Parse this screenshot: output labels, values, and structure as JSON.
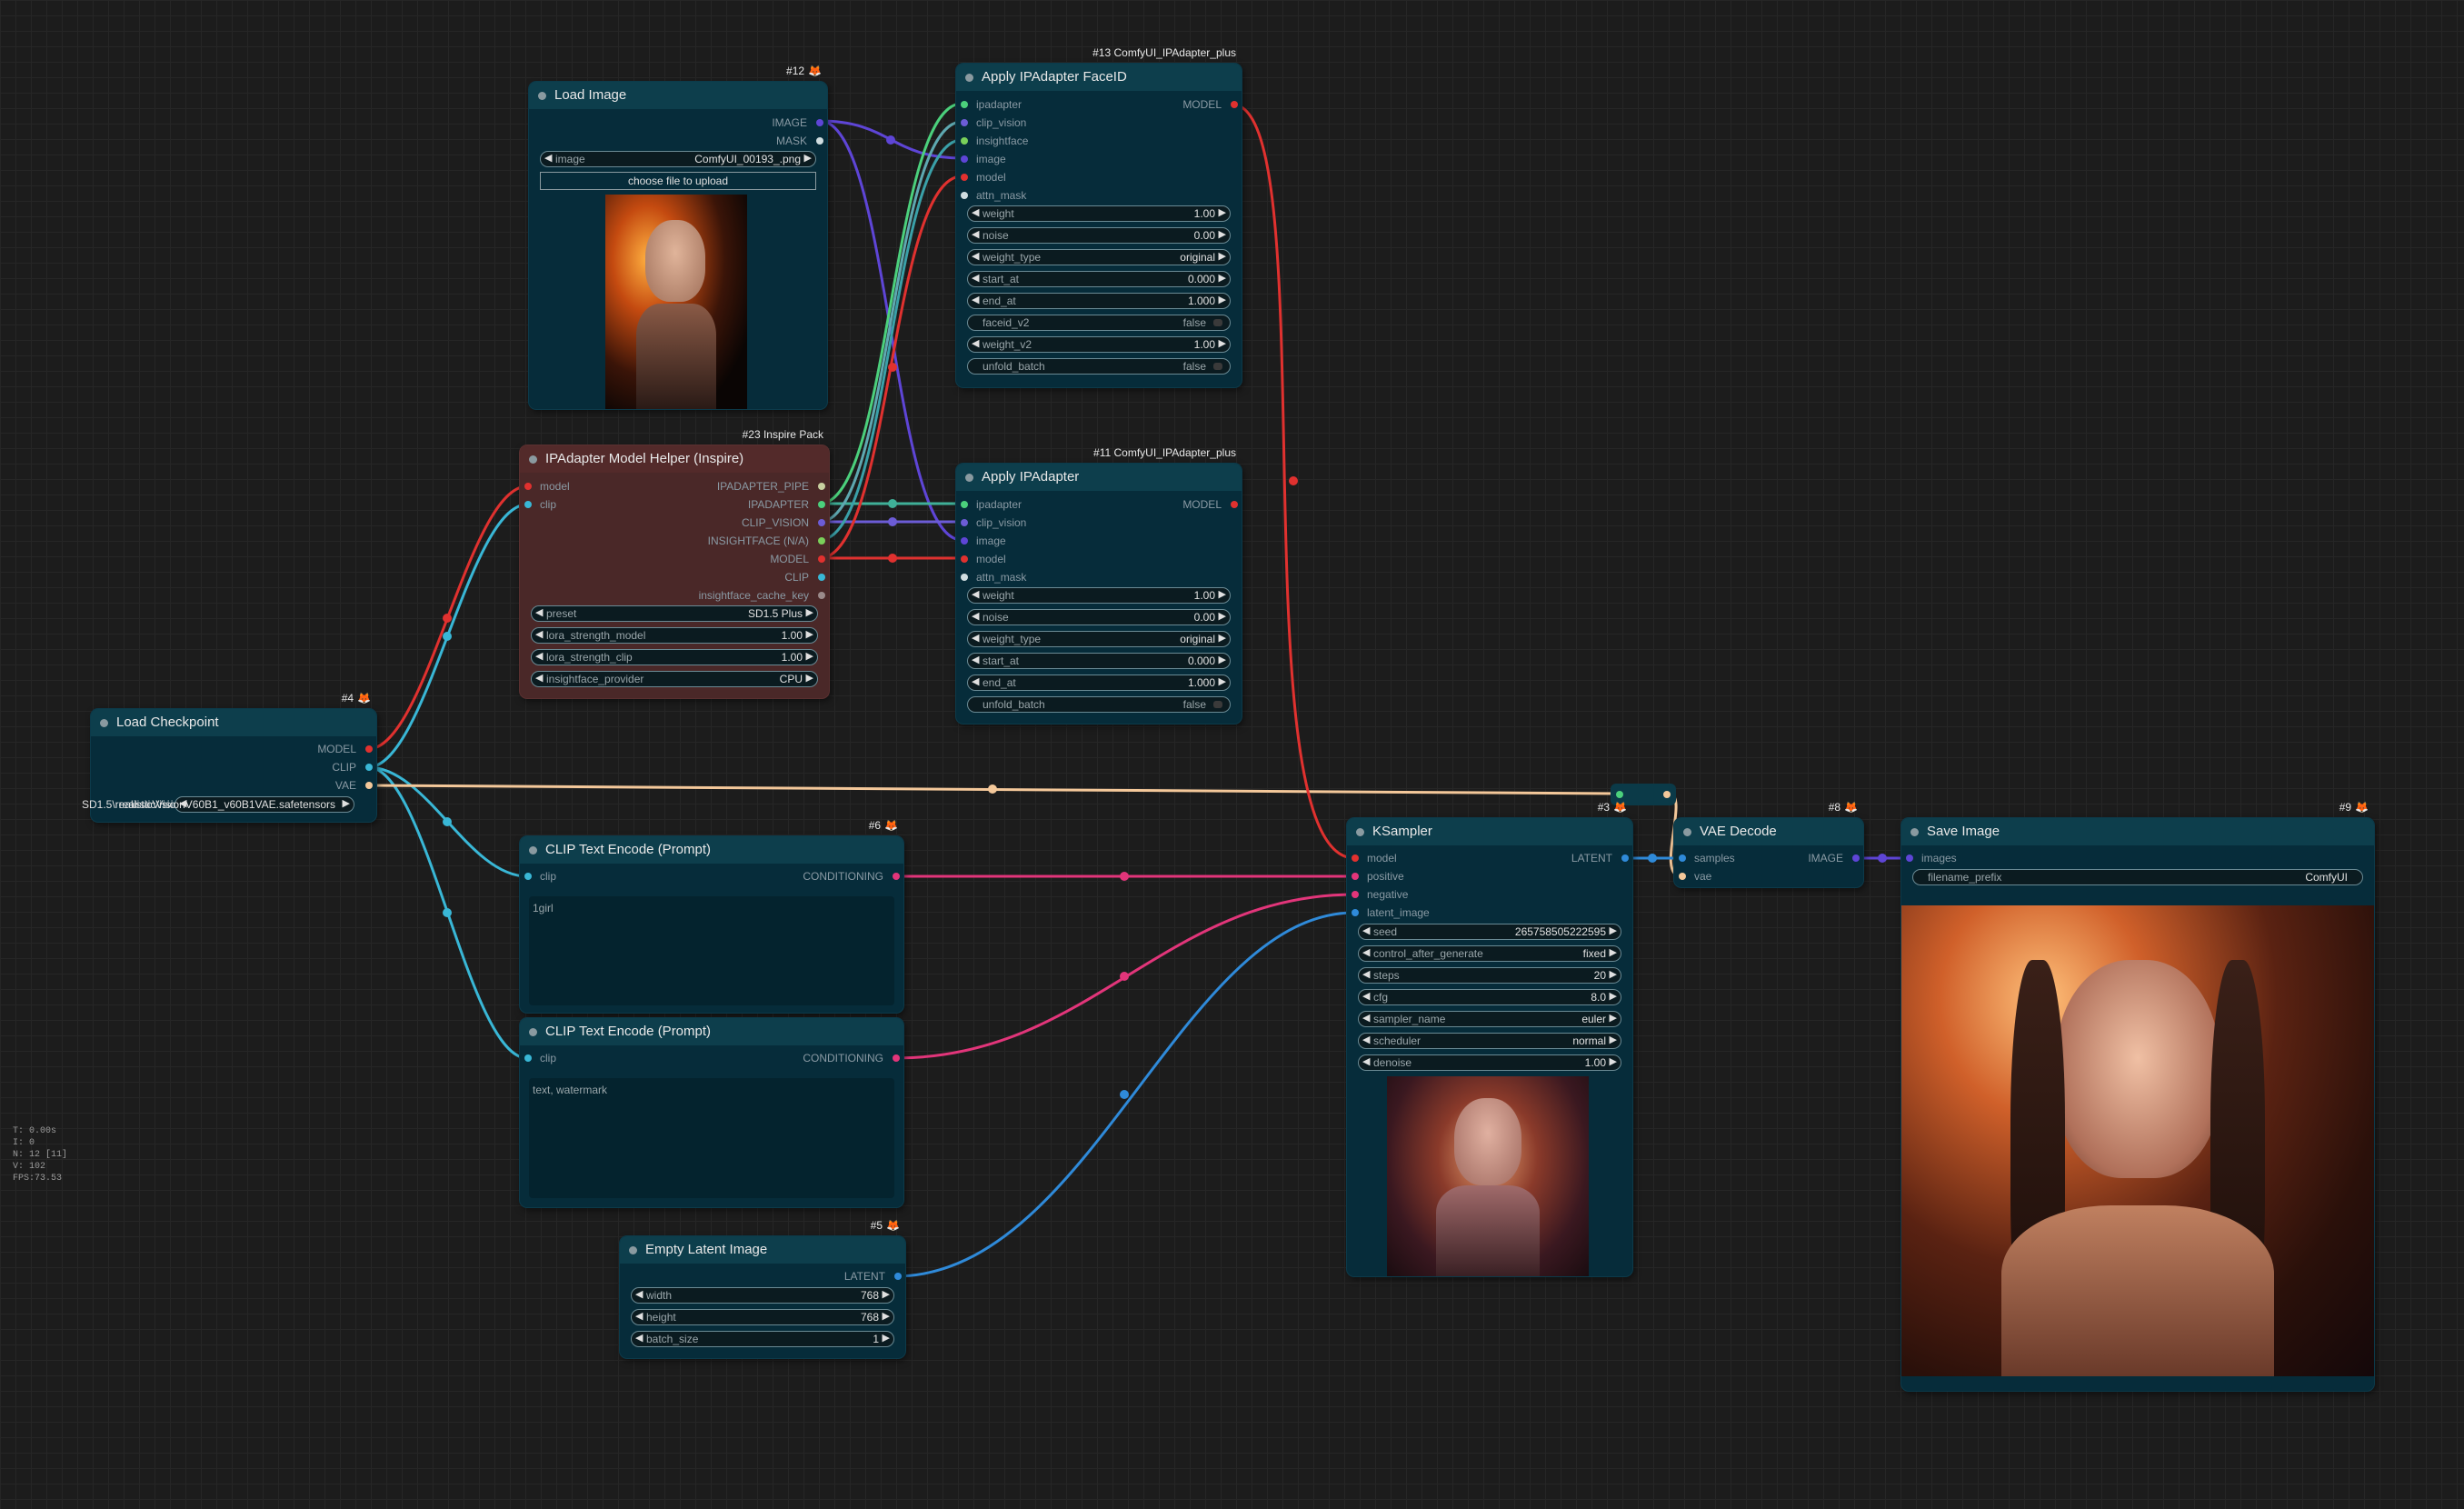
{
  "colors": {
    "canvas_bg": "#1c1c1c",
    "node_bg": "#062c3a",
    "node_header": "#0d3e4c",
    "inspire_node_bg": "#4a2828",
    "model_red": "#e0312f",
    "clip_cyan": "#39b7d6",
    "vae_peach": "#f4c89a",
    "conditioning_pink": "#e2357a",
    "latent_blue": "#2f8ad9",
    "image_purple": "#5e45d6",
    "ipadapter_green": "#4bd07c",
    "clip_vision_violet": "#6c5cd6"
  },
  "stats": [
    "T: 0.00s",
    "I: 0",
    "N: 12 [11]",
    "V: 102",
    "FPS:73.53"
  ],
  "nodes": {
    "load_image": {
      "title": "Load Image",
      "badge": "#12",
      "outputs": [
        "IMAGE",
        "MASK"
      ],
      "image_widget": {
        "label": "image",
        "value": "ComfyUI_00193_.png"
      },
      "upload_button": "choose file to upload"
    },
    "ipadapter_model_helper": {
      "title": "IPAdapter Model Helper (Inspire)",
      "badge": "#23 Inspire Pack",
      "inputs": [
        "model",
        "clip"
      ],
      "outputs": [
        "IPADAPTER_PIPE",
        "IPADAPTER",
        "CLIP_VISION",
        "INSIGHTFACE (N/A)",
        "MODEL",
        "CLIP",
        "insightface_cache_key"
      ],
      "widgets": [
        {
          "label": "preset",
          "value": "SD1.5 Plus"
        },
        {
          "label": "lora_strength_model",
          "value": "1.00"
        },
        {
          "label": "lora_strength_clip",
          "value": "1.00"
        },
        {
          "label": "insightface_provider",
          "value": "CPU"
        }
      ]
    },
    "apply_ipadapter_faceid": {
      "title": "Apply IPAdapter FaceID",
      "badge": "#13 ComfyUI_IPAdapter_plus",
      "inputs": [
        "ipadapter",
        "clip_vision",
        "insightface",
        "image",
        "model",
        "attn_mask"
      ],
      "outputs": [
        "MODEL"
      ],
      "widgets": [
        {
          "label": "weight",
          "value": "1.00"
        },
        {
          "label": "noise",
          "value": "0.00"
        },
        {
          "label": "weight_type",
          "value": "original"
        },
        {
          "label": "start_at",
          "value": "0.000"
        },
        {
          "label": "end_at",
          "value": "1.000"
        }
      ],
      "toggle_faceid_v2": {
        "label": "faceid_v2",
        "value": "false"
      },
      "weight_v2": {
        "label": "weight_v2",
        "value": "1.00"
      },
      "toggle_unfold_batch": {
        "label": "unfold_batch",
        "value": "false"
      }
    },
    "apply_ipadapter": {
      "title": "Apply IPAdapter",
      "badge": "#11 ComfyUI_IPAdapter_plus",
      "inputs": [
        "ipadapter",
        "clip_vision",
        "image",
        "model",
        "attn_mask"
      ],
      "outputs": [
        "MODEL"
      ],
      "widgets": [
        {
          "label": "weight",
          "value": "1.00"
        },
        {
          "label": "noise",
          "value": "0.00"
        },
        {
          "label": "weight_type",
          "value": "original"
        },
        {
          "label": "start_at",
          "value": "0.000"
        },
        {
          "label": "end_at",
          "value": "1.000"
        }
      ],
      "toggle_unfold_batch": {
        "label": "unfold_batch",
        "value": "false"
      }
    },
    "load_checkpoint": {
      "title": "Load Checkpoint",
      "badge": "#4",
      "outputs": [
        "MODEL",
        "CLIP",
        "VAE"
      ],
      "ckpt_prefix": "SD1.5\\realisticVision",
      "ckpt_value": "realisticVisionV60B1_v60B1VAE.safetensors"
    },
    "clip_text_positive": {
      "title": "CLIP Text Encode (Prompt)",
      "badge": "#6",
      "inputs": [
        "clip"
      ],
      "outputs": [
        "CONDITIONING"
      ],
      "text": "1girl"
    },
    "clip_text_negative": {
      "title": "CLIP Text Encode (Prompt)",
      "inputs": [
        "clip"
      ],
      "outputs": [
        "CONDITIONING"
      ],
      "text": "text, watermark"
    },
    "empty_latent": {
      "title": "Empty Latent Image",
      "badge": "#5",
      "outputs": [
        "LATENT"
      ],
      "widgets": [
        {
          "label": "width",
          "value": "768"
        },
        {
          "label": "height",
          "value": "768"
        },
        {
          "label": "batch_size",
          "value": "1"
        }
      ]
    },
    "ksampler": {
      "title": "KSampler",
      "badge": "#3",
      "inputs": [
        "model",
        "positive",
        "negative",
        "latent_image"
      ],
      "outputs": [
        "LATENT"
      ],
      "widgets": [
        {
          "label": "seed",
          "value": "265758505222595"
        },
        {
          "label": "control_after_generate",
          "value": "fixed"
        },
        {
          "label": "steps",
          "value": "20"
        },
        {
          "label": "cfg",
          "value": "8.0"
        },
        {
          "label": "sampler_name",
          "value": "euler"
        },
        {
          "label": "scheduler",
          "value": "normal"
        },
        {
          "label": "denoise",
          "value": "1.00"
        }
      ]
    },
    "vae_decode": {
      "title": "VAE Decode",
      "badge": "#8",
      "inputs": [
        "samples",
        "vae"
      ],
      "outputs": [
        "IMAGE"
      ]
    },
    "save_image": {
      "title": "Save Image",
      "badge": "#9",
      "inputs": [
        "images"
      ],
      "filename_widget": {
        "label": "filename_prefix",
        "value": "ComfyUI"
      }
    }
  }
}
